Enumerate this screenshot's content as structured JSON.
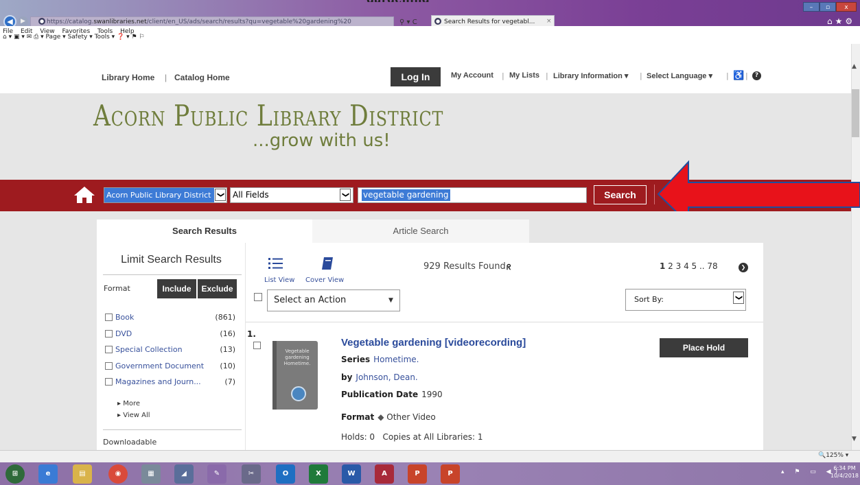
{
  "browser": {
    "url_prefix": "https://catalog.",
    "url_domain": "swanlibraries.net",
    "url_rest": "/client/en_US/ads/search/results?qu=vegetable%20gardening%20",
    "addr_controls": "⚲ ▾ C",
    "tab_title": "Search Results for vegetabl...",
    "tab_close": "×",
    "page_top_text": "gardening",
    "menu": [
      "File",
      "Edit",
      "View",
      "Favorites",
      "Tools",
      "Help"
    ],
    "command_bar": "⌂ ▾  ▣ ▾ ✉ ⎙ ▾  Page ▾  Safety ▾  Tools ▾  ❓ ▾  ⚑  ⚐",
    "window_controls": {
      "min": "–",
      "max": "▫",
      "close": "x"
    },
    "right_icons": "⌂★⚙",
    "zoom": "🔍125%  ▾"
  },
  "topnav": {
    "library_home": "Library Home",
    "sep1": "|",
    "catalog_home": "Catalog Home",
    "login": "Log In",
    "my_account": "My Account",
    "my_lists": "My Lists",
    "library_information": "Library Information",
    "select_language": "Select Language",
    "accessibility": "♿",
    "help": "?"
  },
  "banner": {
    "line1": "Acorn Public Library District",
    "line2": "...grow with us!"
  },
  "search": {
    "library_select": "Acorn Public Library District",
    "field_select": "All Fields",
    "query": "vegetable gardening",
    "button": "Search",
    "dd_arrow": "❯"
  },
  "tabs": {
    "results": "Search Results",
    "article": "Article Search"
  },
  "facets": {
    "title": "Limit Search Results",
    "format_label": "Format",
    "include": "Include",
    "exclude": "Exclude",
    "items": [
      {
        "label": "Book",
        "count": "(861)"
      },
      {
        "label": "DVD",
        "count": "(16)"
      },
      {
        "label": "Special Collection",
        "count": "(13)"
      },
      {
        "label": "Government Document",
        "count": "(10)"
      },
      {
        "label": "Magazines and Journ...",
        "count": "(7)"
      }
    ],
    "more": "▸ More",
    "view_all": "▸ View All",
    "downloadable": "Downloadable"
  },
  "results_header": {
    "list_view": "List View",
    "cover_view": "Cover View",
    "count_text": "929 Results Found",
    "rss": "ᖇ",
    "pages_current": "1",
    "pages_rest": " 2 3 4 5  ..  78",
    "next": "❯",
    "action_select": "Select an Action",
    "action_caret": "▼",
    "sort_label": "Sort By:"
  },
  "result": {
    "number": "1.",
    "cover_text": "Vegetable gardening Hometime.",
    "title": "Vegetable gardening [videorecording]",
    "series_label": "Series",
    "series_value": "Hometime.",
    "by_label": "by",
    "author": "Johnson, Dean.",
    "pubdate_label": "Publication Date",
    "pubdate_value": "1990",
    "format_label": "Format",
    "format_value": "Other Video",
    "holds": "Holds: 0",
    "copies": "Copies at All Libraries: 1",
    "place_hold": "Place Hold"
  },
  "taskbar": {
    "items": [
      "⊞",
      "e",
      "▤",
      "◉",
      "▦",
      "◢",
      "✎",
      "✂",
      "O",
      "X",
      "W",
      "A",
      "P",
      "P"
    ],
    "tray": "▴ ⚑ ▭ ◀)",
    "time": "6:34 PM",
    "date": "10/4/2018"
  },
  "colors": {
    "search_bar_red": "#9e1b1f",
    "logo_green": "#6f7d3c",
    "link_blue": "#37509b",
    "arrow_red": "#e8121a",
    "arrow_blue": "#1f4e9e"
  }
}
